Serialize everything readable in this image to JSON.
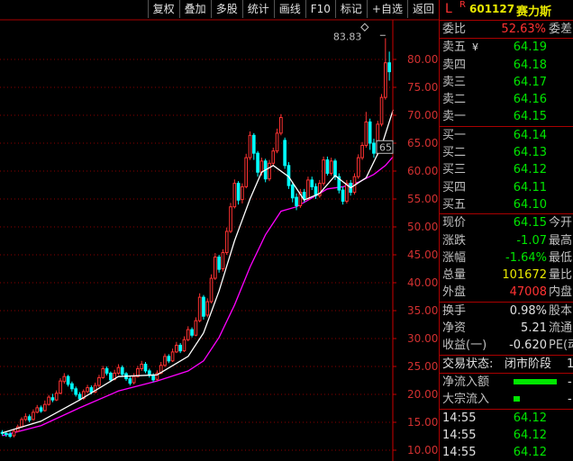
{
  "toolbar": {
    "items": [
      "复权",
      "叠加",
      "多股",
      "统计",
      "画线",
      "F10",
      "标记",
      "+自选",
      "返回"
    ]
  },
  "chart": {
    "price_axis_ticks": [
      "80.00",
      "75.00",
      "70.00",
      "65.00",
      "60.00",
      "55.00",
      "50.00",
      "45.00",
      "40.00",
      "35.00",
      "30.00",
      "25.00",
      "20.00",
      "15.00",
      "10.00"
    ],
    "high_annotation": "83.83",
    "current_marker": "65",
    "colors": {
      "up": "#ff3232",
      "down": "#00ffff",
      "ma_short": "#ffffff",
      "ma_long": "#ff00ff",
      "grid": "#8b0000"
    }
  },
  "chart_data": {
    "type": "candlestick",
    "ylim": [
      9,
      86
    ],
    "candles": [
      [
        13.2,
        13.0,
        13.6,
        12.6
      ],
      [
        13.0,
        12.8,
        13.4,
        12.4
      ],
      [
        12.9,
        12.5,
        13.3,
        12.2
      ],
      [
        12.6,
        13.4,
        13.8,
        12.3
      ],
      [
        13.4,
        14.2,
        14.6,
        13.2
      ],
      [
        14.2,
        15.5,
        15.9,
        14.0
      ],
      [
        15.5,
        16.0,
        16.6,
        15.2
      ],
      [
        16.0,
        15.4,
        16.4,
        15.0
      ],
      [
        15.5,
        16.8,
        17.3,
        15.3
      ],
      [
        16.8,
        17.6,
        18.1,
        16.6
      ],
      [
        17.6,
        17.0,
        18.0,
        16.7
      ],
      [
        17.1,
        18.2,
        18.9,
        16.9
      ],
      [
        18.2,
        19.5,
        19.9,
        18.0
      ],
      [
        19.4,
        19.0,
        20.1,
        18.6
      ],
      [
        19.0,
        20.2,
        20.7,
        18.8
      ],
      [
        20.2,
        22.4,
        22.9,
        20.0
      ],
      [
        22.3,
        23.2,
        23.8,
        21.9
      ],
      [
        23.2,
        21.8,
        23.5,
        21.4
      ],
      [
        21.9,
        21.0,
        22.3,
        20.5
      ],
      [
        21.0,
        20.0,
        21.4,
        19.6
      ],
      [
        20.0,
        19.2,
        20.4,
        18.9
      ],
      [
        19.3,
        20.5,
        20.9,
        19.0
      ],
      [
        20.5,
        21.2,
        21.7,
        20.2
      ],
      [
        21.2,
        20.4,
        21.6,
        20.0
      ],
      [
        20.4,
        21.6,
        22.1,
        20.2
      ],
      [
        21.6,
        23.0,
        23.5,
        21.3
      ],
      [
        23.0,
        24.6,
        25.1,
        22.8
      ],
      [
        24.6,
        23.8,
        25.0,
        23.4
      ],
      [
        23.8,
        22.6,
        24.1,
        22.2
      ],
      [
        22.7,
        23.8,
        24.4,
        22.5
      ],
      [
        23.8,
        24.8,
        25.4,
        23.5
      ],
      [
        24.8,
        23.6,
        25.2,
        23.2
      ],
      [
        23.7,
        22.8,
        24.0,
        22.4
      ],
      [
        22.8,
        22.0,
        23.2,
        21.6
      ],
      [
        22.1,
        23.2,
        23.8,
        21.8
      ],
      [
        23.2,
        24.6,
        25.1,
        23.0
      ],
      [
        24.6,
        25.4,
        26.0,
        24.2
      ],
      [
        25.4,
        24.2,
        25.8,
        23.8
      ],
      [
        24.2,
        23.4,
        24.6,
        23.0
      ],
      [
        23.4,
        22.6,
        23.8,
        22.2
      ],
      [
        22.7,
        23.8,
        24.3,
        22.4
      ],
      [
        23.8,
        25.2,
        25.8,
        23.6
      ],
      [
        25.2,
        26.8,
        27.3,
        24.9
      ],
      [
        26.8,
        26.0,
        27.2,
        25.6
      ],
      [
        26.0,
        27.6,
        28.2,
        25.8
      ],
      [
        27.6,
        28.8,
        29.4,
        27.4
      ],
      [
        28.8,
        27.8,
        29.2,
        27.4
      ],
      [
        27.8,
        29.8,
        30.4,
        27.6
      ],
      [
        29.8,
        31.6,
        32.2,
        29.5
      ],
      [
        31.6,
        30.6,
        32.0,
        30.2
      ],
      [
        30.6,
        33.2,
        33.8,
        30.4
      ],
      [
        33.2,
        37.4,
        38.1,
        32.9
      ],
      [
        37.4,
        34.0,
        37.8,
        33.4
      ],
      [
        34.2,
        36.6,
        37.2,
        33.8
      ],
      [
        36.6,
        40.8,
        41.5,
        36.3
      ],
      [
        40.8,
        44.6,
        45.3,
        40.5
      ],
      [
        44.6,
        42.4,
        45.0,
        41.8
      ],
      [
        42.5,
        45.4,
        46.0,
        42.0
      ],
      [
        45.4,
        49.2,
        49.9,
        45.0
      ],
      [
        49.2,
        53.6,
        54.3,
        48.9
      ],
      [
        53.6,
        57.8,
        58.5,
        53.3
      ],
      [
        57.8,
        54.8,
        58.2,
        54.0
      ],
      [
        54.9,
        57.2,
        57.8,
        54.2
      ],
      [
        57.2,
        62.4,
        63.1,
        56.9
      ],
      [
        62.4,
        66.4,
        67.1,
        62.0
      ],
      [
        66.4,
        63.2,
        66.8,
        62.0
      ],
      [
        63.2,
        59.8,
        63.6,
        59.0
      ],
      [
        59.8,
        61.8,
        62.4,
        59.2
      ],
      [
        61.8,
        58.6,
        62.2,
        58.0
      ],
      [
        58.6,
        61.4,
        62.0,
        58.2
      ],
      [
        61.4,
        63.6,
        64.2,
        61.0
      ],
      [
        63.6,
        66.8,
        67.6,
        63.2
      ],
      [
        66.8,
        69.6,
        70.2,
        66.4
      ],
      [
        65.5,
        61.0,
        66.0,
        60.4
      ],
      [
        61.0,
        57.4,
        61.6,
        56.8
      ],
      [
        57.5,
        55.2,
        58.0,
        54.4
      ],
      [
        55.3,
        53.8,
        56.0,
        53.0
      ],
      [
        53.8,
        56.2,
        56.8,
        53.4
      ],
      [
        56.2,
        55.0,
        56.8,
        54.4
      ],
      [
        55.0,
        58.4,
        59.0,
        54.8
      ],
      [
        58.4,
        57.2,
        59.0,
        56.6
      ],
      [
        57.2,
        55.6,
        57.8,
        55.0
      ],
      [
        55.6,
        57.8,
        58.4,
        55.2
      ],
      [
        57.8,
        62.0,
        62.6,
        57.4
      ],
      [
        62.0,
        59.6,
        62.6,
        59.2
      ],
      [
        59.6,
        61.8,
        62.4,
        59.2
      ],
      [
        61.8,
        59.0,
        62.2,
        58.4
      ],
      [
        59.0,
        56.6,
        59.6,
        56.0
      ],
      [
        56.6,
        54.6,
        57.2,
        54.0
      ],
      [
        54.6,
        57.8,
        58.4,
        54.2
      ],
      [
        57.8,
        56.2,
        58.4,
        55.6
      ],
      [
        56.2,
        59.0,
        59.6,
        55.8
      ],
      [
        59.0,
        62.4,
        63.0,
        58.6
      ],
      [
        62.4,
        64.6,
        65.2,
        62.0
      ],
      [
        64.6,
        68.8,
        70.6,
        64.2
      ],
      [
        68.8,
        65.0,
        69.4,
        63.8
      ],
      [
        65.0,
        63.2,
        65.8,
        62.4
      ],
      [
        63.2,
        68.4,
        69.0,
        62.8
      ],
      [
        68.4,
        73.2,
        73.8,
        68.0
      ],
      [
        73.2,
        79.4,
        83.8,
        72.8
      ],
      [
        79.4,
        77.8,
        81.4,
        76.2
      ]
    ],
    "ma_short": [
      [
        0,
        13.1
      ],
      [
        10,
        15.2
      ],
      [
        20,
        19.0
      ],
      [
        30,
        23.2
      ],
      [
        40,
        23.5
      ],
      [
        48,
        26.8
      ],
      [
        52,
        31.0
      ],
      [
        56,
        38.5
      ],
      [
        60,
        47.5
      ],
      [
        64,
        55.0
      ],
      [
        67,
        59.8
      ],
      [
        70,
        61.0
      ],
      [
        74,
        59.0
      ],
      [
        78,
        54.8
      ],
      [
        82,
        56.0
      ],
      [
        86,
        59.2
      ],
      [
        90,
        57.0
      ],
      [
        94,
        58.8
      ],
      [
        98,
        64.5
      ],
      [
        101,
        71.0
      ]
    ],
    "ma_long": [
      [
        0,
        12.6
      ],
      [
        10,
        14.4
      ],
      [
        20,
        17.6
      ],
      [
        30,
        20.6
      ],
      [
        40,
        22.4
      ],
      [
        48,
        24.2
      ],
      [
        52,
        26.0
      ],
      [
        56,
        30.2
      ],
      [
        60,
        36.0
      ],
      [
        64,
        42.8
      ],
      [
        68,
        48.6
      ],
      [
        72,
        52.8
      ],
      [
        76,
        53.6
      ],
      [
        80,
        55.2
      ],
      [
        84,
        56.8
      ],
      [
        88,
        57.2
      ],
      [
        92,
        58.0
      ],
      [
        96,
        59.4
      ],
      [
        99,
        61.0
      ],
      [
        101,
        62.6
      ]
    ]
  },
  "quote": {
    "flag": "L",
    "r": "R",
    "code": "601127",
    "name": "赛力斯",
    "weibi_label": "委比",
    "weibi_value": "52.63%",
    "weicha_label": "委差",
    "asks": [
      {
        "label": "卖五",
        "price": "64.19",
        "mark": "¥"
      },
      {
        "label": "卖四",
        "price": "64.18",
        "mark": ""
      },
      {
        "label": "卖三",
        "price": "64.17",
        "mark": ""
      },
      {
        "label": "卖二",
        "price": "64.16",
        "mark": ""
      },
      {
        "label": "卖一",
        "price": "64.15",
        "mark": ""
      }
    ],
    "bids": [
      {
        "label": "买一",
        "price": "64.14"
      },
      {
        "label": "买二",
        "price": "64.13"
      },
      {
        "label": "买三",
        "price": "64.12"
      },
      {
        "label": "买四",
        "price": "64.11"
      },
      {
        "label": "买五",
        "price": "64.10"
      }
    ],
    "stats": [
      {
        "label": "现价",
        "value": "64.15",
        "cls": "green",
        "label2": "今开"
      },
      {
        "label": "涨跌",
        "value": "-1.07",
        "cls": "green",
        "label2": "最高"
      },
      {
        "label": "涨幅",
        "value": "-1.64%",
        "cls": "green",
        "label2": "最低"
      },
      {
        "label": "总量",
        "value": "101672",
        "cls": "yellow",
        "label2": "量比"
      },
      {
        "label": "外盘",
        "value": "47008",
        "cls": "red",
        "label2": "内盘"
      }
    ],
    "stats2": [
      {
        "label": "换手",
        "value": "0.98%",
        "label2": "股本"
      },
      {
        "label": "净资",
        "value": "5.21",
        "label2": "流通"
      },
      {
        "label": "收益(一)",
        "value": "-0.620",
        "label2": "PE(动"
      }
    ],
    "trade_status_label": "交易状态:",
    "trade_status_value": "闭市阶段",
    "trade_status_extra": "1",
    "flows": [
      {
        "label": "净流入额",
        "dash": "-",
        "fill": 0.85
      },
      {
        "label": "大宗流入",
        "dash": "-",
        "fill": 0.12
      }
    ],
    "ticks": [
      {
        "time": "14:55",
        "price": "64.12"
      },
      {
        "time": "14:55",
        "price": "64.12"
      },
      {
        "time": "14:55",
        "price": "64.12"
      }
    ]
  }
}
